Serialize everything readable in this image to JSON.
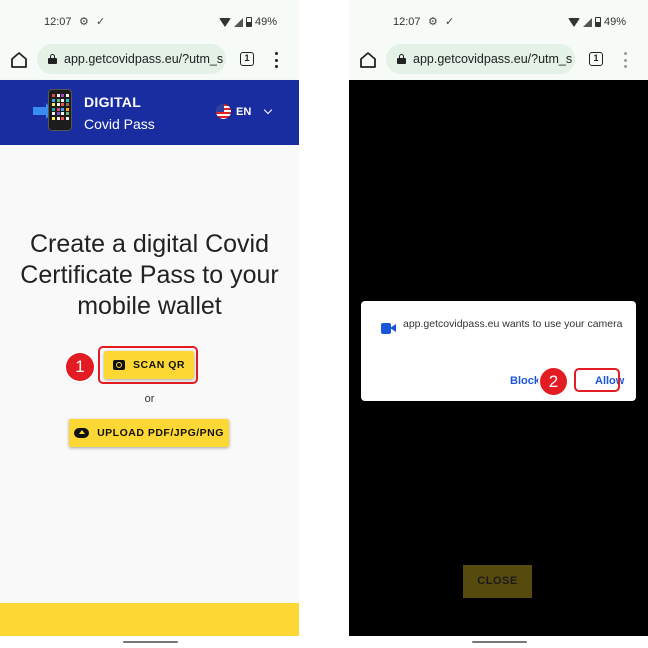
{
  "panels": [
    {
      "status_bar": {
        "time": "12:07",
        "battery": "49%",
        "icons": [
          "settings-icon",
          "download-done-icon",
          "wifi-icon",
          "cell-signal-icon",
          "battery-icon"
        ]
      },
      "address_bar": {
        "url": "app.getcovidpass.eu/?utm_s",
        "tab_count": "1"
      },
      "site": {
        "brand_line_1": "DIGITAL",
        "brand_line_2": "Covid Pass",
        "language": "EN",
        "headline": "Create a digital Covid Certificate Pass to your mobile wallet",
        "scan_button": "SCAN QR",
        "or_text": "or",
        "upload_button": "UPLOAD PDF/JPG/PNG"
      },
      "annotation": "1"
    },
    {
      "status_bar": {
        "time": "12:07",
        "battery": "49%"
      },
      "address_bar": {
        "url": "app.getcovidpass.eu/?utm_s",
        "tab_count": "1"
      },
      "permission_dialog": {
        "message": "app.getcovidpass.eu wants to use your camera",
        "block_label": "Block",
        "allow_label": "Allow"
      },
      "close_button": "CLOSE",
      "annotation": "2"
    }
  ],
  "colors": {
    "header_blue": "#1a2da0",
    "accent_yellow": "#fdd835",
    "annotation_red": "#e31b23",
    "link_blue": "#1a56db"
  }
}
